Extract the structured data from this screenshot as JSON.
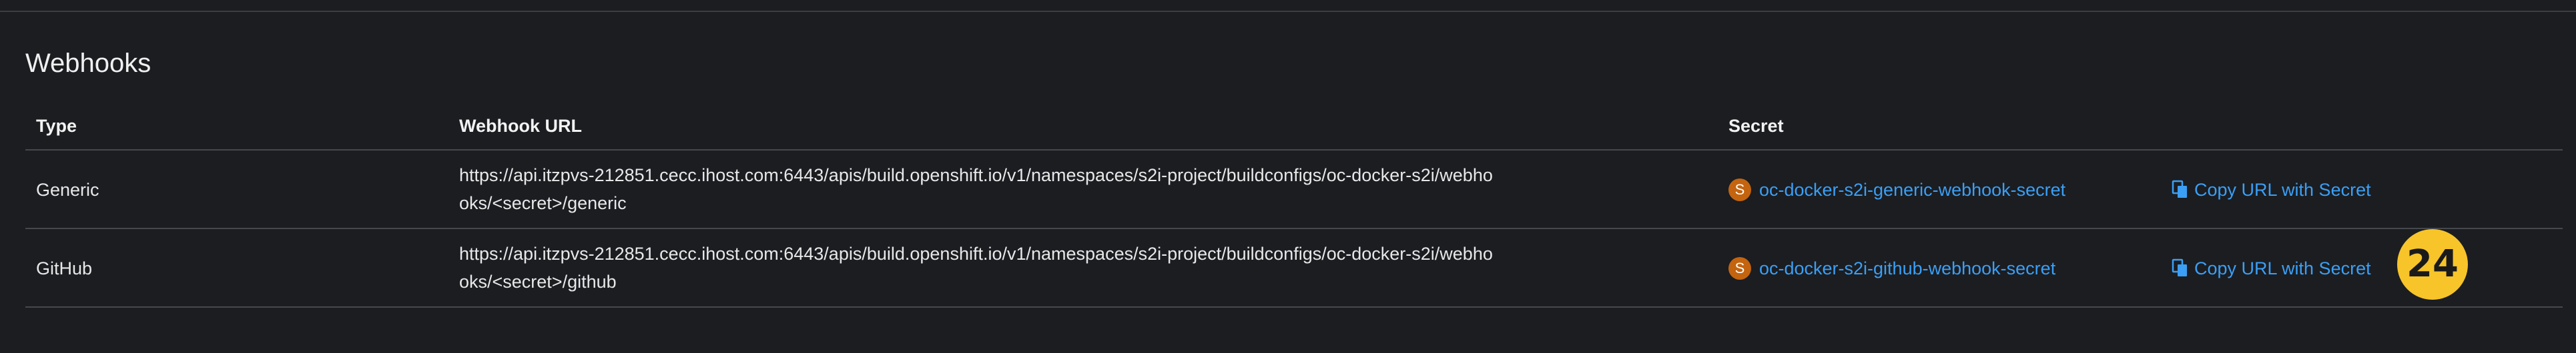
{
  "section": {
    "title": "Webhooks"
  },
  "table": {
    "columns": [
      "Type",
      "Webhook URL",
      "Secret"
    ],
    "rows": [
      {
        "type": "Generic",
        "url": "https://api.itzpvs-212851.cecc.ihost.com:6443/apis/build.openshift.io/v1/namespaces/s2i-project/buildconfigs/oc-docker-s2i/webhooks/<secret>/generic",
        "secret_badge": "S",
        "secret": "oc-docker-s2i-generic-webhook-secret",
        "copy_label": "Copy URL with Secret"
      },
      {
        "type": "GitHub",
        "url": "https://api.itzpvs-212851.cecc.ihost.com:6443/apis/build.openshift.io/v1/namespaces/s2i-project/buildconfigs/oc-docker-s2i/webhooks/<secret>/github",
        "secret_badge": "S",
        "secret": "oc-docker-s2i-github-webhook-secret",
        "copy_label": "Copy URL with Secret"
      }
    ]
  },
  "marker": {
    "label": "24"
  },
  "icons": {
    "copy": "copy-icon",
    "secret_badge": "secret-resource-badge"
  },
  "colors": {
    "background": "#1b1d21",
    "link": "#3b9ff5",
    "badge": "#c4640f",
    "marker": "#f7c429"
  }
}
